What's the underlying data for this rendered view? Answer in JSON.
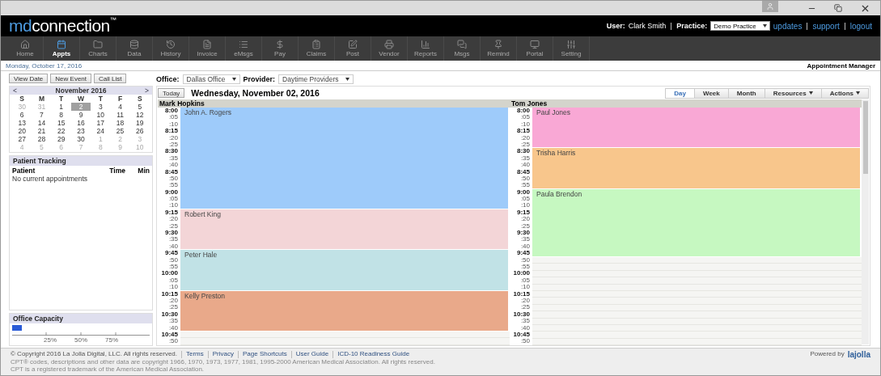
{
  "header": {
    "logo_prefix": "md",
    "logo_suffix": "connection",
    "trademark": "™",
    "user_label": "User:",
    "user_name": "Clark Smith",
    "practice_label": "Practice:",
    "practice": "Demo Practice",
    "links": [
      "updates",
      "support",
      "logout"
    ]
  },
  "toolbar": [
    {
      "label": "Home",
      "selected": false
    },
    {
      "label": "Appts",
      "selected": true
    },
    {
      "label": "Charts",
      "selected": false
    },
    {
      "label": "Data",
      "selected": false
    },
    {
      "label": "History",
      "selected": false
    },
    {
      "label": "Invoice",
      "selected": false
    },
    {
      "label": "eMsgs",
      "selected": false
    },
    {
      "label": "Pay",
      "selected": false
    },
    {
      "label": "Claims",
      "selected": false
    },
    {
      "label": "Post",
      "selected": false
    },
    {
      "label": "Vendor",
      "selected": false
    },
    {
      "label": "Reports",
      "selected": false
    },
    {
      "label": "Msgs",
      "selected": false
    },
    {
      "label": "Remind",
      "selected": false
    },
    {
      "label": "Portal",
      "selected": false
    },
    {
      "label": "Setting",
      "selected": false
    }
  ],
  "date_bar": {
    "date": "Monday, October 17, 2016",
    "title": "Appointment Manager"
  },
  "actions": [
    "View Date",
    "New Event",
    "Call List"
  ],
  "filters": [
    {
      "label": "Office:",
      "value": "Dallas Office"
    },
    {
      "label": "Provider:",
      "value": "Daytime Providers"
    }
  ],
  "mini_calendar": {
    "prev": "<",
    "month": "November 2016",
    "next": ">",
    "weekdays": [
      "S",
      "M",
      "T",
      "W",
      "T",
      "F",
      "S"
    ],
    "weeks": [
      [
        {
          "day": "30",
          "muted": true,
          "selected": false
        },
        {
          "day": "31",
          "muted": true,
          "selected": false
        },
        {
          "day": "1",
          "muted": false,
          "selected": false
        },
        {
          "day": "2",
          "muted": false,
          "selected": true
        },
        {
          "day": "3",
          "muted": false,
          "selected": false
        },
        {
          "day": "4",
          "muted": false,
          "selected": false
        },
        {
          "day": "5",
          "muted": false,
          "selected": false
        }
      ],
      [
        {
          "day": "6",
          "muted": false,
          "selected": false
        },
        {
          "day": "7",
          "muted": false,
          "selected": false
        },
        {
          "day": "8",
          "muted": false,
          "selected": false
        },
        {
          "day": "9",
          "muted": false,
          "selected": false
        },
        {
          "day": "10",
          "muted": false,
          "selected": false
        },
        {
          "day": "11",
          "muted": false,
          "selected": false
        },
        {
          "day": "12",
          "muted": false,
          "selected": false
        }
      ],
      [
        {
          "day": "13",
          "muted": false,
          "selected": false
        },
        {
          "day": "14",
          "muted": false,
          "selected": false
        },
        {
          "day": "15",
          "muted": false,
          "selected": false
        },
        {
          "day": "16",
          "muted": false,
          "selected": false
        },
        {
          "day": "17",
          "muted": false,
          "selected": false
        },
        {
          "day": "18",
          "muted": false,
          "selected": false
        },
        {
          "day": "19",
          "muted": false,
          "selected": false
        }
      ],
      [
        {
          "day": "20",
          "muted": false,
          "selected": false
        },
        {
          "day": "21",
          "muted": false,
          "selected": false
        },
        {
          "day": "22",
          "muted": false,
          "selected": false
        },
        {
          "day": "23",
          "muted": false,
          "selected": false
        },
        {
          "day": "24",
          "muted": false,
          "selected": false
        },
        {
          "day": "25",
          "muted": false,
          "selected": false
        },
        {
          "day": "26",
          "muted": false,
          "selected": false
        }
      ],
      [
        {
          "day": "27",
          "muted": false,
          "selected": false
        },
        {
          "day": "28",
          "muted": false,
          "selected": false
        },
        {
          "day": "29",
          "muted": false,
          "selected": false
        },
        {
          "day": "30",
          "muted": false,
          "selected": false
        },
        {
          "day": "1",
          "muted": true,
          "selected": false
        },
        {
          "day": "2",
          "muted": true,
          "selected": false
        },
        {
          "day": "3",
          "muted": true,
          "selected": false
        }
      ],
      [
        {
          "day": "4",
          "muted": true,
          "selected": false
        },
        {
          "day": "5",
          "muted": true,
          "selected": false
        },
        {
          "day": "6",
          "muted": true,
          "selected": false
        },
        {
          "day": "7",
          "muted": true,
          "selected": false
        },
        {
          "day": "8",
          "muted": true,
          "selected": false
        },
        {
          "day": "9",
          "muted": true,
          "selected": false
        },
        {
          "day": "10",
          "muted": true,
          "selected": false
        }
      ]
    ]
  },
  "patient_tracking": {
    "title": "Patient Tracking",
    "columns": [
      "Patient",
      "Time",
      "Min"
    ],
    "empty": "No current appointments"
  },
  "office_capacity": {
    "title": "Office Capacity",
    "level": 0.07,
    "ticks": [
      "25%",
      "50%",
      "75%"
    ]
  },
  "schedule": {
    "today": "Today",
    "date": "Wednesday, November 02, 2016",
    "views": [
      {
        "label": "Day",
        "selected": true
      },
      {
        "label": "Week",
        "selected": false
      },
      {
        "label": "Month",
        "selected": false
      }
    ],
    "menus": [
      "Resources",
      "Actions"
    ],
    "providers": [
      {
        "name": "Mark Hopkins",
        "blocks": [
          {
            "kind": "appointment",
            "patient": "John A. Rogers",
            "color": "#9ecbfa",
            "times": [
              {
                "t": "8:00",
                "major": true
              },
              {
                "t": ":05",
                "major": false
              },
              {
                "t": ":10",
                "major": false
              },
              {
                "t": "8:15",
                "major": true
              },
              {
                "t": ":20",
                "major": false
              },
              {
                "t": ":25",
                "major": false
              },
              {
                "t": "8:30",
                "major": true
              },
              {
                "t": ":35",
                "major": false
              },
              {
                "t": ":40",
                "major": false
              },
              {
                "t": "8:45",
                "major": true
              },
              {
                "t": ":50",
                "major": false
              },
              {
                "t": ":55",
                "major": false
              },
              {
                "t": "9:00",
                "major": true
              },
              {
                "t": ":05",
                "major": false
              },
              {
                "t": ":10",
                "major": false
              }
            ]
          },
          {
            "kind": "appointment",
            "patient": "Robert King",
            "color": "#f3d5d7",
            "times": [
              {
                "t": "9:15",
                "major": true
              },
              {
                "t": ":20",
                "major": false
              },
              {
                "t": ":25",
                "major": false
              },
              {
                "t": "9:30",
                "major": true
              },
              {
                "t": ":35",
                "major": false
              },
              {
                "t": ":40",
                "major": false
              }
            ]
          },
          {
            "kind": "appointment",
            "patient": "Peter Hale",
            "color": "#c1e2e6",
            "times": [
              {
                "t": "9:45",
                "major": true
              },
              {
                "t": ":50",
                "major": false
              },
              {
                "t": ":55",
                "major": false
              },
              {
                "t": "10:00",
                "major": true
              },
              {
                "t": ":05",
                "major": false
              },
              {
                "t": ":10",
                "major": false
              }
            ]
          },
          {
            "kind": "appointment",
            "patient": "Kelly Preston",
            "color": "#e9a98a",
            "times": [
              {
                "t": "10:15",
                "major": true
              },
              {
                "t": ":20",
                "major": false
              },
              {
                "t": ":25",
                "major": false
              },
              {
                "t": "10:30",
                "major": true
              },
              {
                "t": ":35",
                "major": false
              },
              {
                "t": ":40",
                "major": false
              }
            ]
          },
          {
            "kind": "open",
            "times": [
              {
                "t": "10:45",
                "major": true
              },
              {
                "t": ":50",
                "major": false
              }
            ]
          }
        ]
      },
      {
        "name": "Tom Jones",
        "blocks": [
          {
            "kind": "appointment",
            "patient": "Paul Jones",
            "color": "#f9a8d5",
            "times": [
              {
                "t": "8:00",
                "major": true
              },
              {
                "t": ":05",
                "major": false
              },
              {
                "t": ":10",
                "major": false
              },
              {
                "t": "8:15",
                "major": true
              },
              {
                "t": ":20",
                "major": false
              },
              {
                "t": ":25",
                "major": false
              }
            ]
          },
          {
            "kind": "appointment",
            "patient": "Trisha Harris",
            "color": "#f8c68c",
            "times": [
              {
                "t": "8:30",
                "major": true
              },
              {
                "t": ":35",
                "major": false
              },
              {
                "t": ":40",
                "major": false
              },
              {
                "t": "8:45",
                "major": true
              },
              {
                "t": ":50",
                "major": false
              },
              {
                "t": ":55",
                "major": false
              }
            ]
          },
          {
            "kind": "appointment",
            "patient": "Paula Brendon",
            "color": "#c6f8c1",
            "times": [
              {
                "t": "9:00",
                "major": true
              },
              {
                "t": ":05",
                "major": false
              },
              {
                "t": ":10",
                "major": false
              },
              {
                "t": "9:15",
                "major": true
              },
              {
                "t": ":20",
                "major": false
              },
              {
                "t": ":25",
                "major": false
              },
              {
                "t": "9:30",
                "major": true
              },
              {
                "t": ":35",
                "major": false
              },
              {
                "t": ":40",
                "major": false
              },
              {
                "t": "9:45",
                "major": true
              }
            ]
          },
          {
            "kind": "open",
            "times": [
              {
                "t": ":50",
                "major": false
              },
              {
                "t": ":55",
                "major": false
              },
              {
                "t": "10:00",
                "major": true
              },
              {
                "t": ":05",
                "major": false
              },
              {
                "t": ":10",
                "major": false
              },
              {
                "t": "10:15",
                "major": true
              },
              {
                "t": ":20",
                "major": false
              },
              {
                "t": ":25",
                "major": false
              },
              {
                "t": "10:30",
                "major": true
              },
              {
                "t": ":35",
                "major": false
              },
              {
                "t": ":40",
                "major": false
              },
              {
                "t": "10:45",
                "major": true
              },
              {
                "t": ":50",
                "major": false
              }
            ]
          }
        ]
      }
    ]
  },
  "footer": {
    "copyright": "© Copyright 2016 La Jolla Digital, LLC. All rights reserved.",
    "links": [
      "Terms",
      "Privacy",
      "Page Shortcuts",
      "User Guide",
      "ICD-10 Readiness Guide"
    ],
    "notice": [
      "CPT® codes, descriptions and other data are copyright 1966, 1970, 1973, 1977, 1981, 1995-2000 American Medical Association. All rights reserved.",
      "CPT is a registered trademark of the American Medical Association."
    ],
    "powered_by": "Powered by",
    "brand": "lajolla"
  }
}
